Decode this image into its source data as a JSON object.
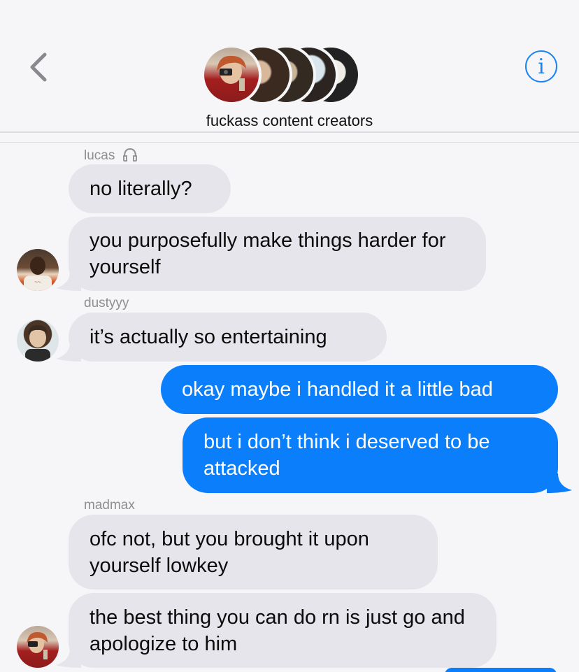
{
  "header": {
    "group_name": "fuckass content creators",
    "back_icon": "chevron-left-icon",
    "info_icon": "info-icon",
    "info_glyph": "i",
    "accent_color": "#1a84f5"
  },
  "messages": [
    {
      "sender": "lucas",
      "sender_icon": "headphones-icon",
      "text": "no literally?",
      "direction": "incoming"
    },
    {
      "sender": "lucas",
      "text": "you purposefully make things harder for yourself",
      "direction": "incoming"
    },
    {
      "sender": "dustyyy",
      "text": "it’s actually so entertaining",
      "direction": "incoming"
    },
    {
      "sender": "me",
      "text": "okay maybe i handled it a little bad",
      "direction": "outgoing"
    },
    {
      "sender": "me",
      "text": "but i don’t think i deserved to be attacked",
      "direction": "outgoing"
    },
    {
      "sender": "madmax",
      "text": "ofc not, but you brought it upon yourself lowkey",
      "direction": "incoming"
    },
    {
      "sender": "madmax",
      "text": "the best thing you can do rn is just go and apologize to him",
      "direction": "incoming"
    }
  ],
  "colors": {
    "incoming_bubble": "#e6e5eb",
    "outgoing_bubble": "#0b7efc",
    "background": "#f6f6f8",
    "sender_label": "#8e8e93"
  }
}
